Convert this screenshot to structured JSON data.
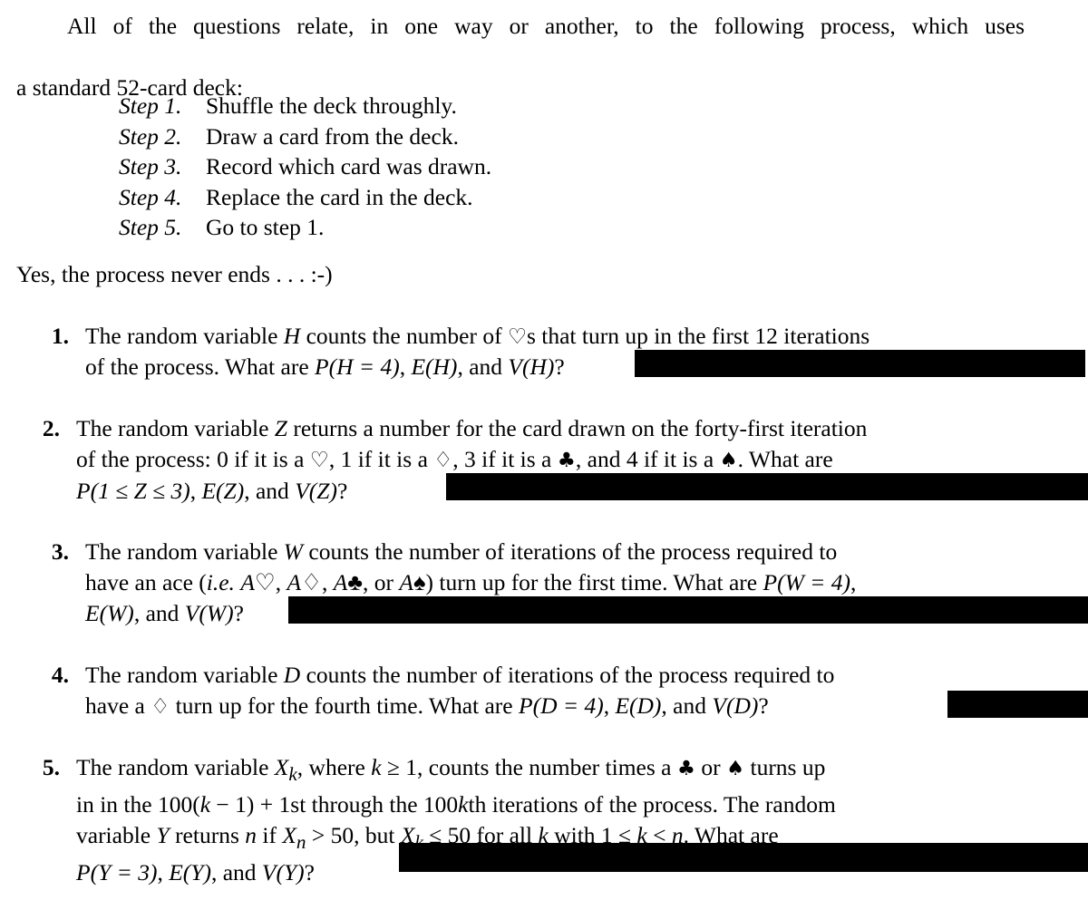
{
  "document": {
    "intro": {
      "text": "All of the questions relate, in one way or another, to the following process, which uses a standard 52-card deck:",
      "line1": "All of the questions relate, in one way or another, to the following process, which uses",
      "line2": "a standard 52-card deck:"
    },
    "steps": [
      {
        "label": "Step 1.",
        "text": "Shuffle the deck throughly."
      },
      {
        "label": "Step 2.",
        "text": "Draw a card from the deck."
      },
      {
        "label": "Step 3.",
        "text": "Record which card was drawn."
      },
      {
        "label": "Step 4.",
        "text": "Replace the card in the deck."
      },
      {
        "label": "Step 5.",
        "text": "Go to step 1."
      }
    ],
    "aside": "Yes, the process never ends . . . :-)",
    "suits": {
      "heart": "♡",
      "diamond": "♢",
      "club": "♣",
      "spade": "♠"
    },
    "questions": [
      {
        "number": "1.",
        "line1": "The random variable H counts the number of ♡s that turn up in the first 12 iterations",
        "line2": "of the process. What are P(H = 4), E(H), and V(H)?",
        "parts": {
          "seg1": "The random variable ",
          "var1": "H",
          "seg2": " counts the number of ",
          "suit1": "♡",
          "seg3": "s that turn up in the first 12 iterations",
          "seg4": "of the process. What are ",
          "math1": "P(H = 4)",
          "seg5": ", ",
          "math2": "E(H)",
          "seg6": ", and ",
          "math3": "V(H)",
          "seg7": "?"
        },
        "redacted": true
      },
      {
        "number": "2.",
        "line1": "The random variable Z returns a number for the card drawn on the forty-first iteration",
        "line2": "of the process: 0 if it is a ♡, 1 if it is a ♢, 3 if it is a ♣, and 4 if it is a ♠. What are",
        "line3": "P(1 ≤ Z ≤ 3), E(Z), and V(Z)?",
        "parts": {
          "seg1": "The random variable ",
          "var1": "Z",
          "seg2": " returns a number for the card drawn on the forty-first iteration",
          "seg3": "of the process: 0 if it is a ",
          "suit1": "♡",
          "seg4": ", 1 if it is a ",
          "suit2": "♢",
          "seg5": ", 3 if it is a ",
          "suit3": "♣",
          "seg6": ", and 4 if it is a ",
          "suit4": "♠",
          "seg7": ". What are",
          "math1": "P(1 ≤ Z ≤ 3)",
          "seg8": ", ",
          "math2": "E(Z)",
          "seg9": ", and ",
          "math3": "V(Z)",
          "seg10": "?"
        },
        "redacted": true
      },
      {
        "number": "3.",
        "line1": "The random variable W counts the number of iterations of the process required to",
        "line2": "have an ace (i.e. A♡, A♢, A♣, or A♠) turn up for the first time. What are P(W = 4),",
        "line3": "E(W), and V(W)?",
        "parts": {
          "seg1": "The random variable ",
          "var1": "W",
          "seg2": " counts the number of iterations of the process required to",
          "seg3": "have an ace (",
          "ie": "i.e.",
          "seg4": " ",
          "ace1": "A♡",
          "seg5": ", ",
          "ace2": "A♢",
          "seg6": ", ",
          "ace3": "A♣",
          "seg7": ", or ",
          "ace4": "A♠",
          "seg8": ") turn up for the first time. What are ",
          "math1": "P(W = 4)",
          "seg9": ",",
          "math2": "E(W)",
          "seg10": ", and ",
          "math3": "V(W)",
          "seg11": "?"
        },
        "redacted": true
      },
      {
        "number": "4.",
        "line1": "The random variable D counts the number of iterations of the process required to",
        "line2": "have a ♢ turn up for the fourth time. What are P(D = 4), E(D), and V(D)?",
        "parts": {
          "seg1": "The random variable ",
          "var1": "D",
          "seg2": " counts the number of iterations of the process required to",
          "seg3": "have a ",
          "suit1": "♢",
          "seg4": " turn up for the fourth time. What are ",
          "math1": "P(D = 4)",
          "seg5": ", ",
          "math2": "E(D)",
          "seg6": ", and ",
          "math3": "V(D)",
          "seg7": "?"
        },
        "redacted": true
      },
      {
        "number": "5.",
        "line1": "The random variable Xk, where k ≥ 1, counts the number times a ♣ or ♠ turns up",
        "line2": "in in the 100(k − 1) + 1st through the 100kth iterations of the process. The random",
        "line3": "variable Y returns n if Xn > 50, but Xk ≤ 50 for all k with 1 ≤ k < n. What are",
        "line4": "P(Y = 3), E(Y), and V(Y)?",
        "parts": {
          "seg1": "The random variable ",
          "var1": "X",
          "sub1": "k",
          "seg2": ", where ",
          "var2": "k",
          "seg3": " ≥ 1, counts the number times a ",
          "suit1": "♣",
          "seg4": " or ",
          "suit2": "♠",
          "seg5": " turns up",
          "seg6": "in in the 100(",
          "var3": "k",
          "seg7": " − 1) + 1st through the 100",
          "var4": "k",
          "seg8": "th iterations of the process. The random",
          "seg9": "variable ",
          "var5": "Y",
          "seg10": " returns ",
          "var6": "n",
          "seg11": " if ",
          "var7": "X",
          "sub2": "n",
          "seg12": " > 50, but ",
          "var8": "X",
          "sub3": "k",
          "seg13": " ≤ 50 for all ",
          "var9": "k",
          "seg14": " with 1 ≤ ",
          "var10": "k",
          "seg15": " < ",
          "var11": "n",
          "seg16": ". What are",
          "math1": "P(Y = 3)",
          "seg17": ", ",
          "math2": "E(Y)",
          "seg18": ", and ",
          "math3": "V(Y)",
          "seg19": "?"
        },
        "redacted": true
      }
    ],
    "colors": {
      "text": "#000000",
      "background": "#ffffff",
      "redaction": "#000000"
    }
  }
}
